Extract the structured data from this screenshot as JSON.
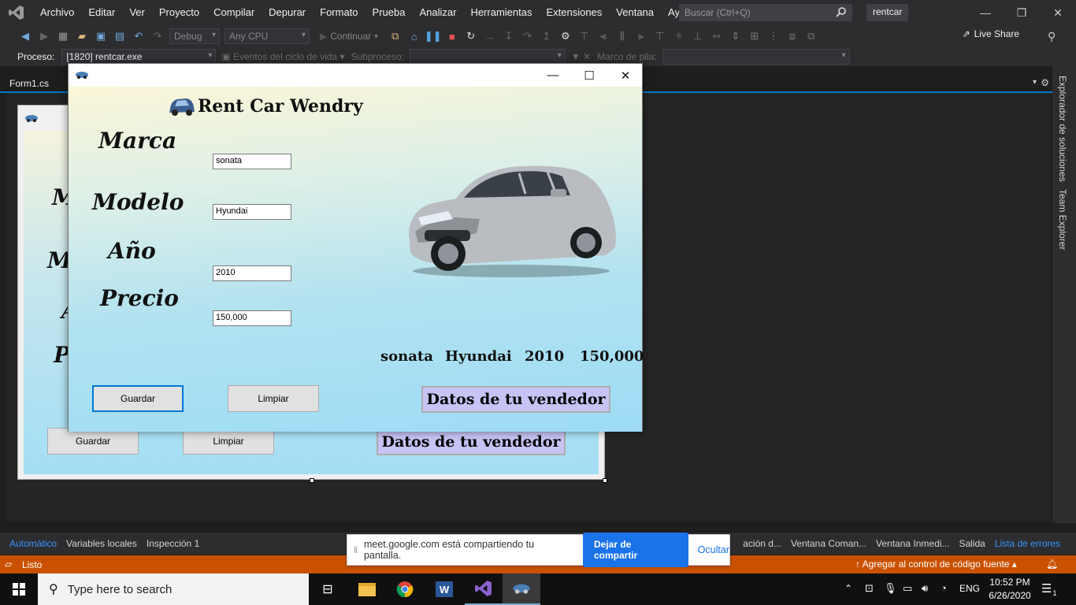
{
  "vs": {
    "menu": [
      "Archivo",
      "Editar",
      "Ver",
      "Proyecto",
      "Compilar",
      "Depurar",
      "Formato",
      "Prueba",
      "Analizar",
      "Herramientas",
      "Extensiones",
      "Ventana",
      "Ayuda"
    ],
    "search_placeholder": "Buscar (Ctrl+Q)",
    "solution": "rentcar",
    "config": "Debug",
    "platform": "Any CPU",
    "continue_label": "Continuar",
    "live_share": "Live Share",
    "process_label": "Proceso:",
    "process_value": "[1820] rentcar.exe",
    "lifecycle_label": "Eventos del ciclo de vida",
    "thread_label": "Subproceso:",
    "stackframe_label": "Marco de pila:",
    "doc_tab": "Form1.cs",
    "right_tabs": [
      "Explorador de soluciones",
      "Team Explorer"
    ],
    "bottom_tabs_left": [
      "Automático",
      "Variables locales",
      "Inspección 1"
    ],
    "bottom_tabs_right": [
      "ación d...",
      "Ventana Coman...",
      "Ventana Inmedi...",
      "Salida",
      "Lista de errores"
    ],
    "status": "Listo",
    "source_control": "Agregar al control de código fuente"
  },
  "app": {
    "title": "Rent Car Wendry",
    "labels": {
      "marca": "Marca",
      "modelo": "Modelo",
      "anio": "Año",
      "precio": "Precio"
    },
    "fields": {
      "marca": "sonata",
      "modelo": "Hyundai",
      "anio": "2010",
      "precio": "150,000"
    },
    "output": {
      "marca": "sonata",
      "modelo": "Hyundai",
      "anio": "2010",
      "precio": "150,000"
    },
    "buttons": {
      "save": "Guardar",
      "clear": "Limpiar",
      "seller": "Datos de tu vendedor"
    },
    "design_ghost_letters": [
      "M",
      "M",
      "A",
      "P"
    ]
  },
  "share": {
    "message": "meet.google.com está compartiendo tu pantalla.",
    "stop": "Dejar de compartir",
    "hide": "Ocultar"
  },
  "taskbar": {
    "search_placeholder": "Type here to search",
    "lang": "ENG",
    "time": "10:52 PM",
    "date": "6/26/2020",
    "notifications": "1"
  },
  "colors": {
    "vs_accent": "#007acc",
    "status_orange": "#ca5100",
    "share_blue": "#1a73e8",
    "seller_button": "#c7c3f4"
  }
}
